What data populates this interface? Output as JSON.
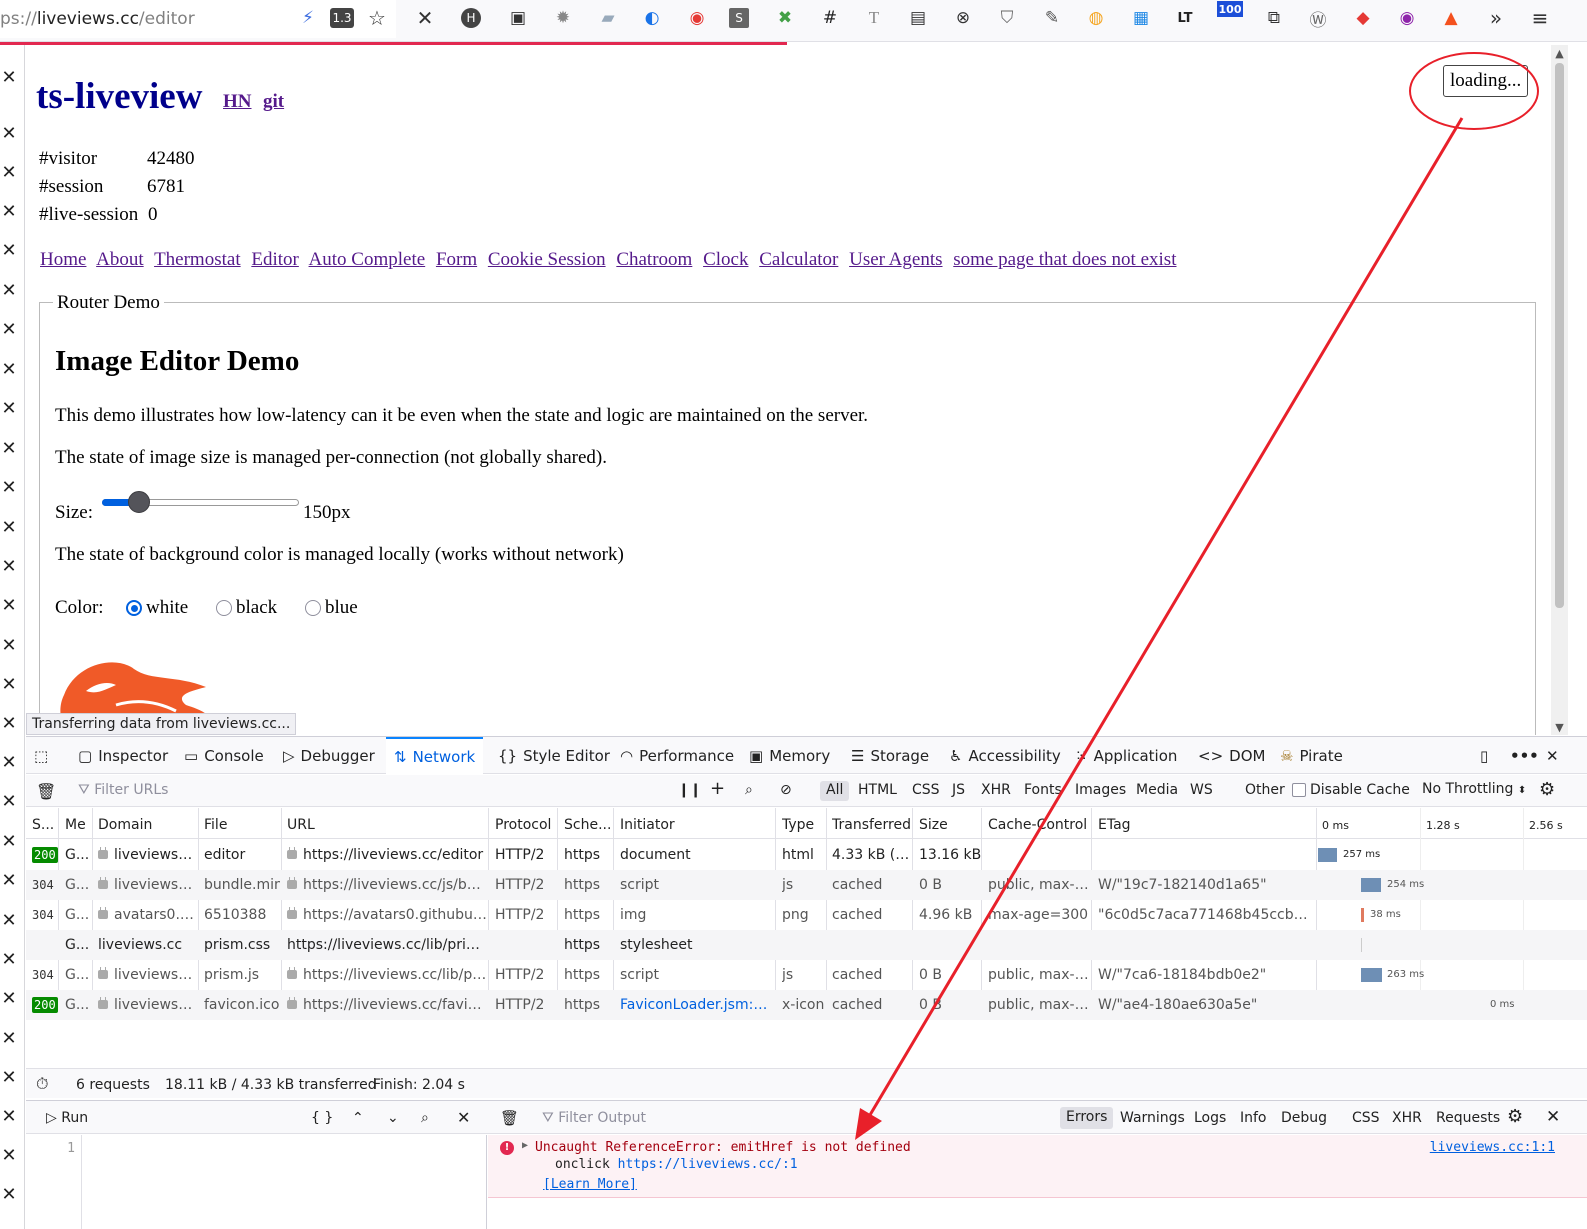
{
  "browser": {
    "url_prefix": "ps://",
    "url_host": "liveviews.cc",
    "url_path": "/editor",
    "zoom": "1.3",
    "badge_100": "100",
    "status_text": "Transferring data from liveviews.cc..."
  },
  "page": {
    "title": "ts-liveview",
    "hn_link": "HN",
    "git_link": "git",
    "stats": [
      {
        "label": "#visitor",
        "value": "42480"
      },
      {
        "label": "#session",
        "value": "6781"
      },
      {
        "label": "#live-session",
        "value": "0"
      }
    ],
    "nav": [
      "Home",
      "About",
      "Thermostat",
      "Editor",
      "Auto Complete",
      "Form",
      "Cookie Session",
      "Chatroom",
      "Clock",
      "Calculator",
      "User Agents",
      "some page that does not exist"
    ],
    "legend": "Router Demo",
    "heading": "Image Editor Demo",
    "para1": "This demo illustrates how low-latency can it be even when the state and logic are maintained on the server.",
    "para2": "The state of image size is managed per-connection (not globally shared).",
    "size_label": "Size:",
    "size_value": "150px",
    "size_level": 0.15,
    "para3": "The state of background color is managed locally (works without network)",
    "color_label": "Color:",
    "colors": [
      "white",
      "black",
      "blue"
    ],
    "selected_color": "white",
    "loading_text": "loading..."
  },
  "devtools": {
    "tabs": [
      "Inspector",
      "Console",
      "Debugger",
      "Network",
      "Style Editor",
      "Performance",
      "Memory",
      "Storage",
      "Accessibility",
      "Application",
      "DOM",
      "Pirate"
    ],
    "active_tab": "Network",
    "filter_placeholder": "Filter URLs",
    "type_filters": [
      "All",
      "HTML",
      "CSS",
      "JS",
      "XHR",
      "Fonts",
      "Images",
      "Media",
      "WS",
      "Other"
    ],
    "disable_cache": "Disable Cache",
    "throttling": "No Throttling",
    "columns": [
      "S...",
      "Me",
      "Domain",
      "File",
      "URL",
      "Protocol",
      "Sche...",
      "Initiator",
      "Type",
      "Transferred",
      "Size",
      "Cache-Control",
      "ETag"
    ],
    "timeline_ticks": [
      "0 ms",
      "1.28 s",
      "2.56 s"
    ],
    "rows": [
      {
        "status": "200",
        "method": "G...",
        "domain": "liveviews.cc",
        "file": "editor",
        "url": "https://liveviews.cc/editor",
        "protocol": "HTTP/2",
        "scheme": "https",
        "initiator": "document",
        "type": "html",
        "transferred": "4.33 kB (r...",
        "size": "13.16 kB",
        "cache": "",
        "etag": "",
        "timing": "257 ms",
        "secure": true
      },
      {
        "status": "304",
        "method": "G...",
        "domain": "liveviews.cc",
        "file": "bundle.min.js",
        "url": "https://liveviews.cc/js/bundl...",
        "protocol": "HTTP/2",
        "scheme": "https",
        "initiator": "script",
        "type": "js",
        "transferred": "cached",
        "size": "0 B",
        "cache": "public, max-a...",
        "etag": "W/\"19c7-182140d1a65\"",
        "timing": "254 ms",
        "secure": true
      },
      {
        "status": "304",
        "method": "G...",
        "domain": "avatars0.gi...",
        "file": "6510388",
        "url": "https://avatars0.githubuser...",
        "protocol": "HTTP/2",
        "scheme": "https",
        "initiator": "img",
        "type": "png",
        "transferred": "cached",
        "size": "4.96 kB",
        "cache": "max-age=300",
        "etag": "\"6c0d5c7aca771468b45ccb3615...",
        "timing": "38 ms",
        "secure": true
      },
      {
        "status": "",
        "method": "G...",
        "domain": "liveviews.cc",
        "file": "prism.css",
        "url": "https://liveviews.cc/lib/prism/p...",
        "protocol": "",
        "scheme": "https",
        "initiator": "stylesheet",
        "type": "",
        "transferred": "",
        "size": "",
        "cache": "",
        "etag": "",
        "timing": "",
        "secure": false
      },
      {
        "status": "304",
        "method": "G...",
        "domain": "liveviews.cc",
        "file": "prism.js",
        "url": "https://liveviews.cc/lib/pris...",
        "protocol": "HTTP/2",
        "scheme": "https",
        "initiator": "script",
        "type": "js",
        "transferred": "cached",
        "size": "0 B",
        "cache": "public, max-a...",
        "etag": "W/\"7ca6-18184bdb0e2\"",
        "timing": "263 ms",
        "secure": true
      },
      {
        "status": "200",
        "method": "G...",
        "domain": "liveviews.cc",
        "file": "favicon.ico",
        "url": "https://liveviews.cc/favicon.i...",
        "protocol": "HTTP/2",
        "scheme": "https",
        "initiator": "FaviconLoader.jsm:186...",
        "type": "x-icon",
        "transferred": "cached",
        "size": "0 B",
        "cache": "public, max-a...",
        "etag": "W/\"ae4-180ae630a5e\"",
        "timing": "0 ms",
        "secure": true
      }
    ],
    "summary": {
      "requests": "6 requests",
      "transferred": "18.11 kB / 4.33 kB transferred",
      "finish": "Finish: 2.04 s"
    },
    "console": {
      "run": "Run",
      "braces": "{ }",
      "filter_placeholder": "Filter Output",
      "levels": [
        "Errors",
        "Warnings",
        "Logs",
        "Info",
        "Debug"
      ],
      "extra": [
        "CSS",
        "XHR",
        "Requests"
      ],
      "line_number": "1",
      "error_message": "Uncaught ReferenceError: emitHref is not defined",
      "error_sub_prefix": "onclick",
      "error_sub_link": "https://liveviews.cc/:1",
      "learn_more": "[Learn More]",
      "source": "liveviews.cc:1:1"
    }
  },
  "colors": {
    "accent": "#0060df",
    "annotation": "#e8202a",
    "error_bg": "#fdf2f5",
    "status_ok": "#058b00"
  }
}
